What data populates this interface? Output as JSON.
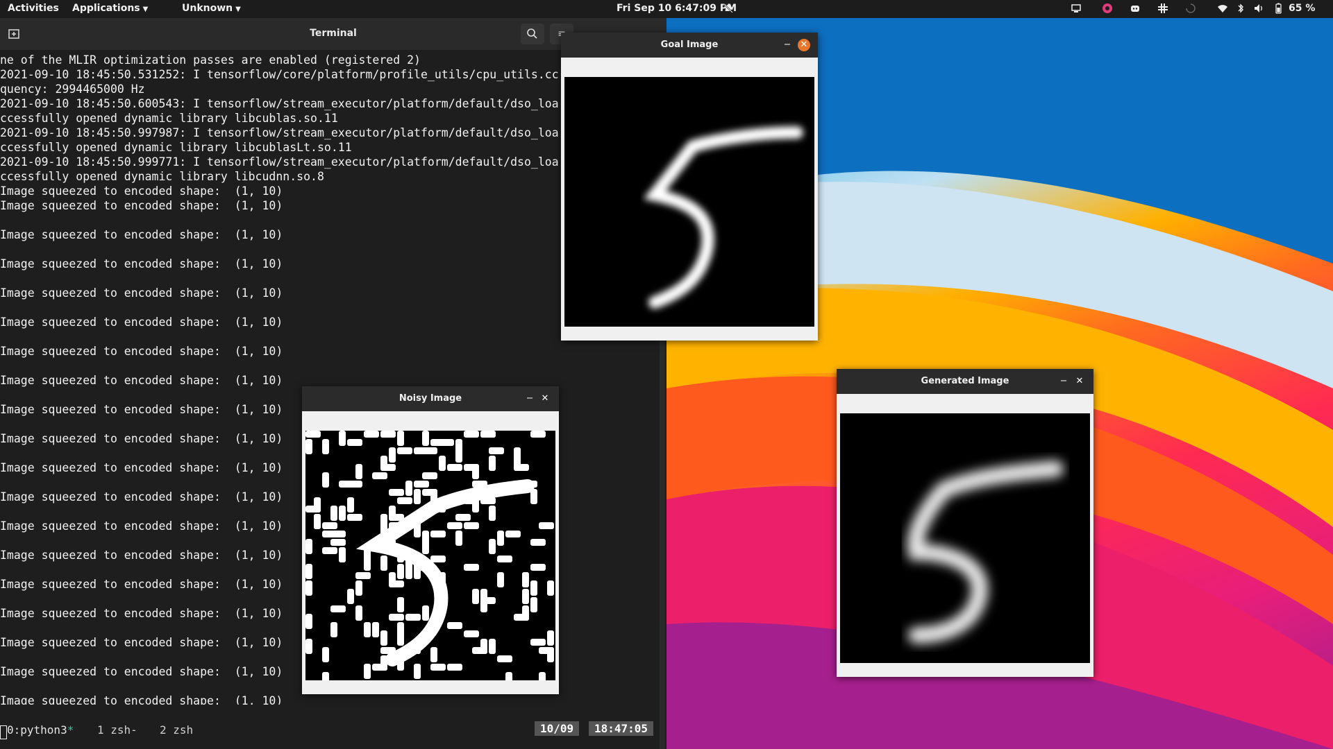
{
  "topbar": {
    "activities": "Activities",
    "applications": "Applications",
    "unknown": "Unknown",
    "clock": "Fri Sep 10  6:47:09 PM",
    "battery": "65 %",
    "icons": [
      "notifications-off-icon",
      "screen-icon",
      "app-icon",
      "discord-icon",
      "slack-icon",
      "loading-icon",
      "wifi-icon",
      "bluetooth-icon",
      "volume-icon",
      "battery-icon"
    ]
  },
  "terminal": {
    "title": "Terminal",
    "lines": [
      "ne of the MLIR optimization passes are enabled (registered 2)",
      "2021-09-10 18:45:50.531252: I tensorflow/core/platform/profile_utils/cpu_utils.cc",
      "quency: 2994465000 Hz",
      "2021-09-10 18:45:50.600543: I tensorflow/stream_executor/platform/default/dso_loa",
      "ccessfully opened dynamic library libcublas.so.11",
      "2021-09-10 18:45:50.997987: I tensorflow/stream_executor/platform/default/dso_loa",
      "ccessfully opened dynamic library libcublasLt.so.11",
      "2021-09-10 18:45:50.999771: I tensorflow/stream_executor/platform/default/dso_loa",
      "ccessfully opened dynamic library libcudnn.so.8",
      "Image squeezed to encoded shape:  (1, 10)",
      "Image squeezed to encoded shape:  (1, 10)",
      "",
      "Image squeezed to encoded shape:  (1, 10)",
      "",
      "Image squeezed to encoded shape:  (1, 10)",
      "",
      "Image squeezed to encoded shape:  (1, 10)",
      "",
      "Image squeezed to encoded shape:  (1, 10)",
      "",
      "Image squeezed to encoded shape:  (1, 10)",
      "",
      "Image squeezed to encoded shape:  (1, 10)",
      "",
      "Image squeezed to encoded shape:  (1, 10)",
      "",
      "Image squeezed to encoded shape:  (1, 10)",
      "",
      "Image squeezed to encoded shape:  (1, 10)",
      "",
      "Image squeezed to encoded shape:  (1, 10)",
      "",
      "Image squeezed to encoded shape:  (1, 10)",
      "",
      "Image squeezed to encoded shape:  (1, 10)",
      "",
      "Image squeezed to encoded shape:  (1, 10)",
      "",
      "Image squeezed to encoded shape:  (1, 10)",
      "",
      "Image squeezed to encoded shape:  (1, 10)",
      "",
      "Image squeezed to encoded shape:  (1, 10)",
      "",
      "Image squeezed to encoded shape:  (1, 10)"
    ],
    "status": {
      "win0": "0:python3",
      "win0_flag": "*",
      "win1": "1 zsh-",
      "win2": "2 zsh",
      "date": "10/09",
      "time": "18:47:05"
    }
  },
  "windows": {
    "goal": {
      "title": "Goal Image"
    },
    "noisy": {
      "title": "Noisy Image"
    },
    "generated": {
      "title": "Generated Image"
    }
  },
  "buttons": {
    "minimize": "‒",
    "close": "✕"
  }
}
